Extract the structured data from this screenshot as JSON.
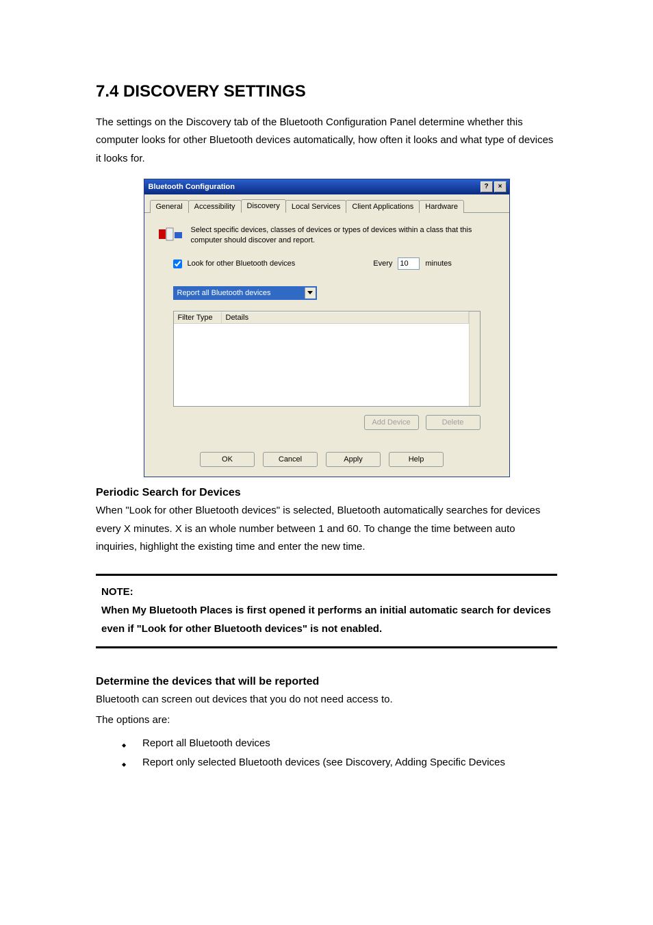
{
  "section": {
    "heading": "7.4 DISCOVERY SETTINGS",
    "intro": "The settings on the Discovery tab of the Bluetooth Configuration Panel determine whether this computer looks for other Bluetooth devices automatically, how often it looks and what type of devices it looks for."
  },
  "dialog": {
    "title": "Bluetooth Configuration",
    "help_btn": "?",
    "close_btn": "×",
    "tabs": {
      "general": "General",
      "accessibility": "Accessibility",
      "discovery": "Discovery",
      "local_services": "Local Services",
      "client_apps": "Client Applications",
      "hardware": "Hardware"
    },
    "desc": "Select specific devices, classes of devices or types of devices within a class that this computer should discover and report.",
    "look_label": "Look for other Bluetooth devices",
    "every_label": "Every",
    "interval_value": "10",
    "minutes_label": "minutes",
    "combo_value": "Report all Bluetooth devices",
    "columns": {
      "filter_type": "Filter Type",
      "details": "Details"
    },
    "add_device": "Add Device",
    "delete": "Delete",
    "ok": "OK",
    "cancel": "Cancel",
    "apply": "Apply",
    "help": "Help"
  },
  "periodic": {
    "heading": "Periodic Search for Devices",
    "body": "When \"Look for other Bluetooth devices\" is selected, Bluetooth automatically searches for devices every X minutes. X is an whole number between 1 and 60. To change the time between auto inquiries, highlight the existing time and enter the new time."
  },
  "note": {
    "label": "NOTE:",
    "text": "When My Bluetooth Places is first opened it performs an initial automatic search for devices even if \"Look for other Bluetooth devices\" is not enabled."
  },
  "determine": {
    "heading": "Determine the devices that will be reported",
    "p1": "Bluetooth can screen out devices that you do not need access to.",
    "p2": "The options are:",
    "bullets": [
      "Report all Bluetooth devices",
      "Report only selected Bluetooth devices (see Discovery, Adding Specific Devices"
    ]
  }
}
